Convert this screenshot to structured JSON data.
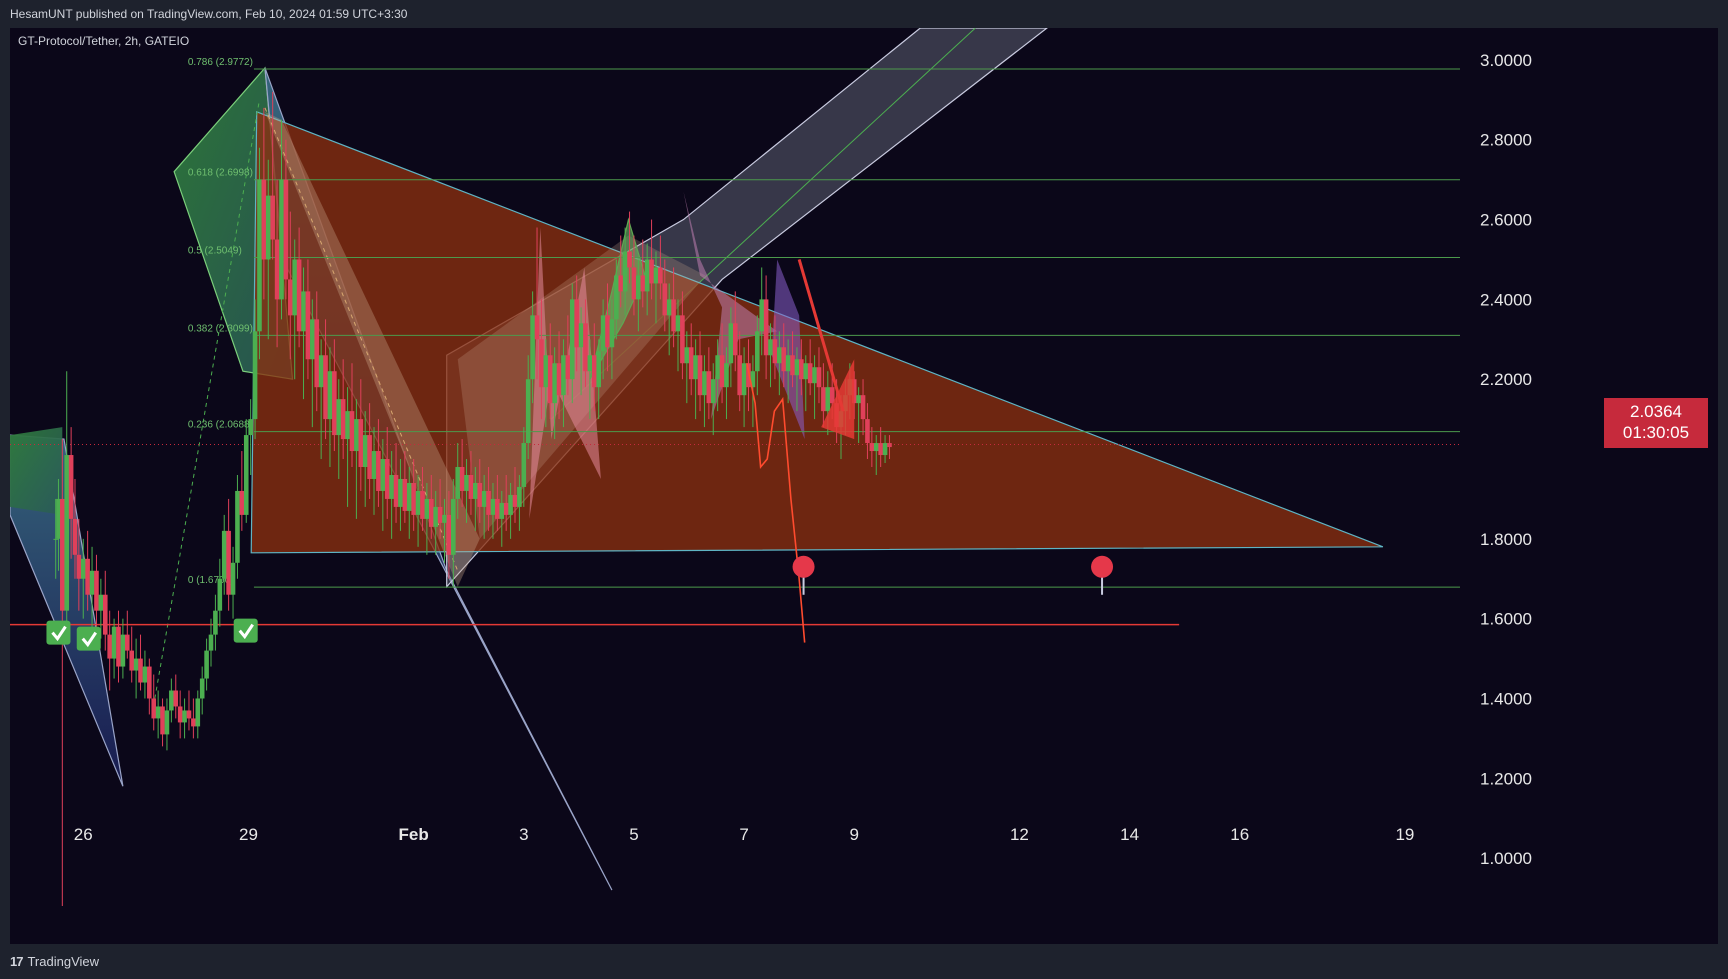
{
  "header": {
    "published": "HesamUNT published on TradingView.com, Feb 10, 2024 01:59 UTC+3:30"
  },
  "symbol": {
    "label": "GT-Protocol/Tether, 2h, GATEIO"
  },
  "footer": {
    "brand": "TradingView",
    "logo": "tradingview-logo-icon"
  },
  "price_tag": {
    "price": "2.0364",
    "countdown": "01:30:05"
  },
  "colors": {
    "background": "#0b0719",
    "up": "#4caf50",
    "down": "#e0405a",
    "triangle": "#8b2f0f",
    "fib": "#4c9a4c",
    "support": "#e53935",
    "price_tag": "#c62a3c"
  },
  "chart_data": {
    "type": "candlestick",
    "y_ticks": [
      "3.0000",
      "2.8000",
      "2.6000",
      "2.4000",
      "2.2000",
      "1.8000",
      "1.6000",
      "1.4000",
      "1.2000",
      "1.0000"
    ],
    "ylim": [
      0.87,
      3.08
    ],
    "x_ticks": [
      {
        "label": "26",
        "day": 0
      },
      {
        "label": "29",
        "day": 3
      },
      {
        "label": "Feb",
        "day": 6,
        "bold": true
      },
      {
        "label": "3",
        "day": 8
      },
      {
        "label": "5",
        "day": 10
      },
      {
        "label": "7",
        "day": 12
      },
      {
        "label": "9",
        "day": 14
      },
      {
        "label": "12",
        "day": 17
      },
      {
        "label": "14",
        "day": 19
      },
      {
        "label": "16",
        "day": 21
      },
      {
        "label": "19",
        "day": 24
      }
    ],
    "xlim": [
      -1.33,
      25.0
    ],
    "fib_levels": [
      {
        "label": "0.786 (2.9772)",
        "value": 2.9772
      },
      {
        "label": "0.618 (2.6998)",
        "value": 2.6998
      },
      {
        "label": "0.5 (2.5049)",
        "value": 2.5049
      },
      {
        "label": "0.382 (2.3099)",
        "value": 2.3099
      },
      {
        "label": "0.236 (2.0688)",
        "value": 2.0688
      },
      {
        "label": "0 (1.6790)",
        "value": 1.679
      }
    ],
    "support_level": 1.585,
    "current_price": 2.0364,
    "candles": [
      [
        -0.5,
        1.8,
        1.9,
        1.7,
        1.8
      ],
      [
        -0.45,
        1.8,
        1.95,
        1.72,
        1.9
      ],
      [
        -0.38,
        1.9,
        2.05,
        0.88,
        1.62
      ],
      [
        -0.3,
        1.62,
        2.22,
        1.55,
        2.01
      ],
      [
        -0.22,
        2.01,
        2.08,
        1.75,
        1.85
      ],
      [
        -0.15,
        1.85,
        1.95,
        1.7,
        1.76
      ],
      [
        -0.08,
        1.76,
        1.85,
        1.62,
        1.7
      ],
      [
        0.0,
        1.7,
        1.8,
        1.6,
        1.75
      ],
      [
        0.08,
        1.75,
        1.82,
        1.62,
        1.66
      ],
      [
        0.16,
        1.66,
        1.78,
        1.55,
        1.72
      ],
      [
        0.24,
        1.72,
        1.76,
        1.58,
        1.62
      ],
      [
        0.32,
        1.62,
        1.7,
        1.55,
        1.66
      ],
      [
        0.4,
        1.66,
        1.72,
        1.52,
        1.56
      ],
      [
        0.48,
        1.56,
        1.62,
        1.42,
        1.5
      ],
      [
        0.56,
        1.5,
        1.6,
        1.45,
        1.58
      ],
      [
        0.64,
        1.58,
        1.62,
        1.44,
        1.48
      ],
      [
        0.72,
        1.48,
        1.6,
        1.45,
        1.56
      ],
      [
        0.8,
        1.56,
        1.62,
        1.5,
        1.52
      ],
      [
        0.88,
        1.52,
        1.58,
        1.44,
        1.47
      ],
      [
        0.96,
        1.47,
        1.55,
        1.4,
        1.5
      ],
      [
        1.04,
        1.5,
        1.56,
        1.42,
        1.44
      ],
      [
        1.12,
        1.44,
        1.52,
        1.4,
        1.48
      ],
      [
        1.2,
        1.48,
        1.5,
        1.36,
        1.4
      ],
      [
        1.28,
        1.4,
        1.46,
        1.32,
        1.35
      ],
      [
        1.36,
        1.35,
        1.42,
        1.3,
        1.38
      ],
      [
        1.44,
        1.38,
        1.4,
        1.28,
        1.31
      ],
      [
        1.52,
        1.31,
        1.4,
        1.27,
        1.37
      ],
      [
        1.6,
        1.37,
        1.45,
        1.34,
        1.42
      ],
      [
        1.68,
        1.42,
        1.46,
        1.35,
        1.38
      ],
      [
        1.76,
        1.38,
        1.42,
        1.3,
        1.34
      ],
      [
        1.84,
        1.34,
        1.4,
        1.3,
        1.37
      ],
      [
        1.92,
        1.37,
        1.42,
        1.32,
        1.35
      ],
      [
        2.0,
        1.35,
        1.4,
        1.3,
        1.33
      ],
      [
        2.08,
        1.33,
        1.42,
        1.3,
        1.4
      ],
      [
        2.16,
        1.4,
        1.48,
        1.36,
        1.45
      ],
      [
        2.24,
        1.45,
        1.55,
        1.42,
        1.52
      ],
      [
        2.32,
        1.52,
        1.6,
        1.48,
        1.56
      ],
      [
        2.4,
        1.56,
        1.66,
        1.52,
        1.62
      ],
      [
        2.48,
        1.62,
        1.75,
        1.58,
        1.7
      ],
      [
        2.56,
        1.7,
        1.86,
        1.66,
        1.82
      ],
      [
        2.64,
        1.82,
        1.9,
        1.62,
        1.66
      ],
      [
        2.72,
        1.66,
        1.78,
        1.6,
        1.74
      ],
      [
        2.8,
        1.74,
        1.96,
        1.7,
        1.92
      ],
      [
        2.88,
        1.92,
        2.02,
        1.82,
        1.86
      ],
      [
        2.96,
        1.86,
        2.1,
        1.84,
        2.06
      ],
      [
        3.04,
        2.06,
        2.15,
        1.96,
        2.1
      ],
      [
        3.12,
        2.1,
        2.4,
        2.05,
        2.32
      ],
      [
        3.2,
        2.32,
        2.78,
        2.25,
        2.7
      ],
      [
        3.28,
        2.7,
        2.88,
        2.4,
        2.5
      ],
      [
        3.36,
        2.5,
        2.75,
        2.3,
        2.66
      ],
      [
        3.44,
        2.66,
        2.92,
        2.5,
        2.55
      ],
      [
        3.52,
        2.55,
        2.7,
        2.28,
        2.4
      ],
      [
        3.6,
        2.4,
        2.85,
        2.35,
        2.7
      ],
      [
        3.68,
        2.7,
        2.8,
        2.4,
        2.45
      ],
      [
        3.76,
        2.45,
        2.62,
        2.25,
        2.36
      ],
      [
        3.84,
        2.36,
        2.55,
        2.2,
        2.5
      ],
      [
        3.92,
        2.5,
        2.58,
        2.28,
        2.32
      ],
      [
        4.0,
        2.32,
        2.48,
        2.15,
        2.42
      ],
      [
        4.08,
        2.42,
        2.5,
        2.2,
        2.25
      ],
      [
        4.16,
        2.25,
        2.4,
        2.08,
        2.35
      ],
      [
        4.24,
        2.35,
        2.42,
        2.12,
        2.18
      ],
      [
        4.32,
        2.18,
        2.3,
        2.0,
        2.26
      ],
      [
        4.4,
        2.26,
        2.35,
        2.05,
        2.1
      ],
      [
        4.48,
        2.1,
        2.28,
        1.98,
        2.22
      ],
      [
        4.56,
        2.22,
        2.3,
        2.02,
        2.06
      ],
      [
        4.64,
        2.06,
        2.2,
        1.95,
        2.15
      ],
      [
        4.72,
        2.15,
        2.25,
        2.0,
        2.05
      ],
      [
        4.8,
        2.05,
        2.18,
        1.88,
        2.12
      ],
      [
        4.88,
        2.12,
        2.24,
        1.98,
        2.02
      ],
      [
        4.96,
        2.02,
        2.15,
        1.85,
        2.1
      ],
      [
        5.04,
        2.1,
        2.2,
        1.92,
        1.98
      ],
      [
        5.12,
        1.98,
        2.12,
        1.88,
        2.06
      ],
      [
        5.2,
        2.06,
        2.14,
        1.9,
        1.95
      ],
      [
        5.28,
        1.95,
        2.08,
        1.86,
        2.02
      ],
      [
        5.36,
        2.02,
        2.1,
        1.88,
        1.92
      ],
      [
        5.44,
        1.92,
        2.05,
        1.82,
        2.0
      ],
      [
        5.52,
        2.0,
        2.08,
        1.85,
        1.9
      ],
      [
        5.6,
        1.9,
        2.02,
        1.8,
        1.96
      ],
      [
        5.68,
        1.96,
        2.04,
        1.84,
        1.88
      ],
      [
        5.76,
        1.88,
        2.0,
        1.82,
        1.95
      ],
      [
        5.84,
        1.95,
        2.02,
        1.84,
        1.87
      ],
      [
        5.92,
        1.87,
        1.98,
        1.8,
        1.94
      ],
      [
        6.0,
        1.94,
        2.0,
        1.82,
        1.86
      ],
      [
        6.08,
        1.86,
        1.96,
        1.78,
        1.92
      ],
      [
        6.16,
        1.92,
        1.98,
        1.82,
        1.85
      ],
      [
        6.24,
        1.85,
        1.94,
        1.76,
        1.9
      ],
      [
        6.32,
        1.9,
        1.96,
        1.8,
        1.83
      ],
      [
        6.4,
        1.83,
        1.92,
        1.76,
        1.88
      ],
      [
        6.48,
        1.88,
        1.95,
        1.8,
        1.84
      ],
      [
        6.56,
        1.84,
        1.9,
        1.74,
        1.86
      ],
      [
        6.64,
        1.86,
        1.92,
        1.7,
        1.76
      ],
      [
        6.72,
        1.76,
        1.95,
        1.68,
        1.9
      ],
      [
        6.8,
        1.9,
        2.04,
        1.85,
        1.98
      ],
      [
        6.88,
        1.98,
        2.05,
        1.88,
        1.92
      ],
      [
        6.96,
        1.92,
        2.0,
        1.84,
        1.96
      ],
      [
        7.04,
        1.96,
        2.02,
        1.86,
        1.9
      ],
      [
        7.12,
        1.9,
        1.98,
        1.82,
        1.94
      ],
      [
        7.2,
        1.94,
        2.0,
        1.84,
        1.88
      ],
      [
        7.28,
        1.88,
        1.96,
        1.8,
        1.92
      ],
      [
        7.36,
        1.92,
        1.98,
        1.82,
        1.86
      ],
      [
        7.44,
        1.86,
        1.94,
        1.8,
        1.9
      ],
      [
        7.52,
        1.9,
        1.96,
        1.82,
        1.85
      ],
      [
        7.6,
        1.85,
        1.92,
        1.78,
        1.89
      ],
      [
        7.68,
        1.89,
        1.96,
        1.82,
        1.86
      ],
      [
        7.76,
        1.86,
        1.94,
        1.8,
        1.91
      ],
      [
        7.84,
        1.91,
        1.98,
        1.84,
        1.88
      ],
      [
        7.92,
        1.88,
        1.96,
        1.82,
        1.93
      ],
      [
        8.0,
        1.93,
        2.08,
        1.88,
        2.04
      ],
      [
        8.08,
        2.04,
        2.26,
        2.0,
        2.2
      ],
      [
        8.16,
        2.2,
        2.42,
        2.14,
        2.36
      ],
      [
        8.24,
        2.36,
        2.58,
        2.2,
        2.3
      ],
      [
        8.32,
        2.3,
        2.4,
        2.1,
        2.18
      ],
      [
        8.4,
        2.18,
        2.3,
        2.08,
        2.26
      ],
      [
        8.48,
        2.26,
        2.34,
        2.1,
        2.14
      ],
      [
        8.56,
        2.14,
        2.28,
        2.05,
        2.24
      ],
      [
        8.64,
        2.24,
        2.32,
        2.1,
        2.16
      ],
      [
        8.72,
        2.16,
        2.3,
        2.08,
        2.26
      ],
      [
        8.8,
        2.26,
        2.36,
        2.16,
        2.2
      ],
      [
        8.88,
        2.2,
        2.44,
        2.14,
        2.4
      ],
      [
        8.96,
        2.4,
        2.46,
        2.22,
        2.28
      ],
      [
        9.04,
        2.28,
        2.38,
        2.16,
        2.34
      ],
      [
        9.12,
        2.34,
        2.4,
        2.18,
        2.22
      ],
      [
        9.2,
        2.22,
        2.3,
        2.1,
        2.26
      ],
      [
        9.28,
        2.26,
        2.34,
        2.12,
        2.18
      ],
      [
        9.36,
        2.18,
        2.3,
        2.1,
        2.27
      ],
      [
        9.44,
        2.27,
        2.4,
        2.2,
        2.36
      ],
      [
        9.52,
        2.36,
        2.44,
        2.22,
        2.28
      ],
      [
        9.6,
        2.28,
        2.4,
        2.2,
        2.35
      ],
      [
        9.68,
        2.35,
        2.5,
        2.3,
        2.46
      ],
      [
        9.76,
        2.46,
        2.56,
        2.38,
        2.42
      ],
      [
        9.84,
        2.42,
        2.58,
        2.36,
        2.52
      ],
      [
        9.92,
        2.52,
        2.62,
        2.44,
        2.48
      ],
      [
        10.0,
        2.48,
        2.56,
        2.36,
        2.4
      ],
      [
        10.08,
        2.4,
        2.5,
        2.32,
        2.46
      ],
      [
        10.16,
        2.46,
        2.55,
        2.38,
        2.42
      ],
      [
        10.24,
        2.42,
        2.54,
        2.36,
        2.5
      ],
      [
        10.32,
        2.5,
        2.6,
        2.4,
        2.44
      ],
      [
        10.4,
        2.44,
        2.52,
        2.34,
        2.48
      ],
      [
        10.48,
        2.48,
        2.56,
        2.4,
        2.44
      ],
      [
        10.56,
        2.44,
        2.5,
        2.32,
        2.36
      ],
      [
        10.64,
        2.36,
        2.44,
        2.26,
        2.4
      ],
      [
        10.72,
        2.4,
        2.48,
        2.28,
        2.32
      ],
      [
        10.8,
        2.32,
        2.4,
        2.22,
        2.36
      ],
      [
        10.88,
        2.36,
        2.42,
        2.2,
        2.24
      ],
      [
        10.96,
        2.24,
        2.32,
        2.14,
        2.28
      ],
      [
        11.04,
        2.28,
        2.34,
        2.16,
        2.2
      ],
      [
        11.12,
        2.2,
        2.3,
        2.1,
        2.26
      ],
      [
        11.2,
        2.26,
        2.32,
        2.12,
        2.16
      ],
      [
        11.28,
        2.16,
        2.26,
        2.08,
        2.22
      ],
      [
        11.36,
        2.22,
        2.28,
        2.1,
        2.14
      ],
      [
        11.44,
        2.14,
        2.24,
        2.06,
        2.2
      ],
      [
        11.52,
        2.2,
        2.3,
        2.12,
        2.26
      ],
      [
        11.6,
        2.26,
        2.34,
        2.14,
        2.18
      ],
      [
        11.68,
        2.18,
        2.28,
        2.1,
        2.24
      ],
      [
        11.76,
        2.24,
        2.38,
        2.18,
        2.34
      ],
      [
        11.84,
        2.34,
        2.42,
        2.22,
        2.26
      ],
      [
        11.92,
        2.26,
        2.32,
        2.12,
        2.16
      ],
      [
        12.0,
        2.16,
        2.28,
        2.08,
        2.24
      ],
      [
        12.08,
        2.24,
        2.3,
        2.12,
        2.18
      ],
      [
        12.16,
        2.18,
        2.26,
        2.08,
        2.22
      ],
      [
        12.24,
        2.22,
        2.36,
        2.16,
        2.32
      ],
      [
        12.32,
        2.32,
        2.48,
        2.26,
        2.4
      ],
      [
        12.4,
        2.4,
        2.46,
        2.2,
        2.26
      ],
      [
        12.48,
        2.26,
        2.34,
        2.18,
        2.3
      ],
      [
        12.56,
        2.3,
        2.36,
        2.2,
        2.24
      ],
      [
        12.64,
        2.24,
        2.32,
        2.16,
        2.28
      ],
      [
        12.72,
        2.28,
        2.34,
        2.18,
        2.22
      ],
      [
        12.8,
        2.22,
        2.3,
        2.14,
        2.26
      ],
      [
        12.88,
        2.26,
        2.32,
        2.18,
        2.21
      ],
      [
        12.96,
        2.21,
        2.28,
        2.12,
        2.25
      ],
      [
        13.04,
        2.25,
        2.3,
        2.16,
        2.2
      ],
      [
        13.12,
        2.2,
        2.26,
        2.12,
        2.24
      ],
      [
        13.2,
        2.24,
        2.3,
        2.16,
        2.19
      ],
      [
        13.28,
        2.19,
        2.26,
        2.1,
        2.23
      ],
      [
        13.36,
        2.23,
        2.28,
        2.14,
        2.18
      ],
      [
        13.44,
        2.18,
        2.24,
        2.08,
        2.12
      ],
      [
        13.52,
        2.12,
        2.22,
        2.06,
        2.18
      ],
      [
        13.6,
        2.18,
        2.24,
        2.1,
        2.14
      ],
      [
        13.68,
        2.14,
        2.2,
        2.04,
        2.08
      ],
      [
        13.76,
        2.08,
        2.16,
        2.0,
        2.12
      ],
      [
        13.84,
        2.12,
        2.2,
        2.06,
        2.16
      ],
      [
        13.92,
        2.16,
        2.24,
        2.1,
        2.2
      ],
      [
        14.0,
        2.2,
        2.22,
        2.1,
        2.14
      ],
      [
        14.08,
        2.14,
        2.18,
        2.04,
        2.16
      ],
      [
        14.16,
        2.16,
        2.2,
        2.06,
        2.1
      ],
      [
        14.24,
        2.1,
        2.14,
        2.0,
        2.04
      ],
      [
        14.32,
        2.04,
        2.08,
        1.98,
        2.02
      ],
      [
        14.4,
        2.02,
        2.06,
        1.96,
        2.04
      ],
      [
        14.48,
        2.04,
        2.08,
        1.98,
        2.01
      ],
      [
        14.56,
        2.01,
        2.06,
        1.99,
        2.04
      ],
      [
        14.64,
        2.04,
        2.06,
        2.0,
        2.03
      ]
    ]
  }
}
